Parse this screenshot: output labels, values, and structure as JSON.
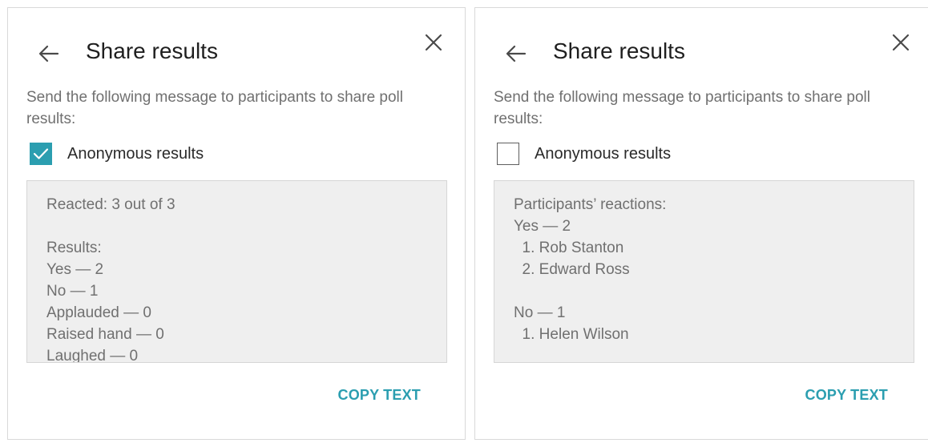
{
  "colors": {
    "accent": "#2b9eb0",
    "title_text": "#1f1f1f",
    "secondary_text": "#707070",
    "message_background": "#efefef"
  },
  "panels": [
    {
      "title": "Share results",
      "back_icon": "arrow-left-icon",
      "close_icon": "close-icon",
      "description": "Send the following message to participants to share poll results:",
      "anonymous_checkbox": {
        "label": "Anonymous results",
        "checked": true
      },
      "message_lines": [
        "Reacted: 3 out of 3",
        "",
        "Results:",
        "Yes — 2",
        "No — 1",
        "Applauded — 0",
        "Raised hand — 0",
        "Laughed — 0"
      ],
      "copy_button": "COPY TEXT"
    },
    {
      "title": "Share results",
      "back_icon": "arrow-left-icon",
      "close_icon": "close-icon",
      "description": "Send the following message to participants to share poll results:",
      "anonymous_checkbox": {
        "label": "Anonymous results",
        "checked": false
      },
      "message_lines": [
        "Participants’ reactions:",
        "Yes — 2",
        "  1. Rob Stanton",
        "  2. Edward Ross",
        "",
        "No — 1",
        "  1. Helen Wilson"
      ],
      "copy_button": "COPY TEXT"
    }
  ]
}
